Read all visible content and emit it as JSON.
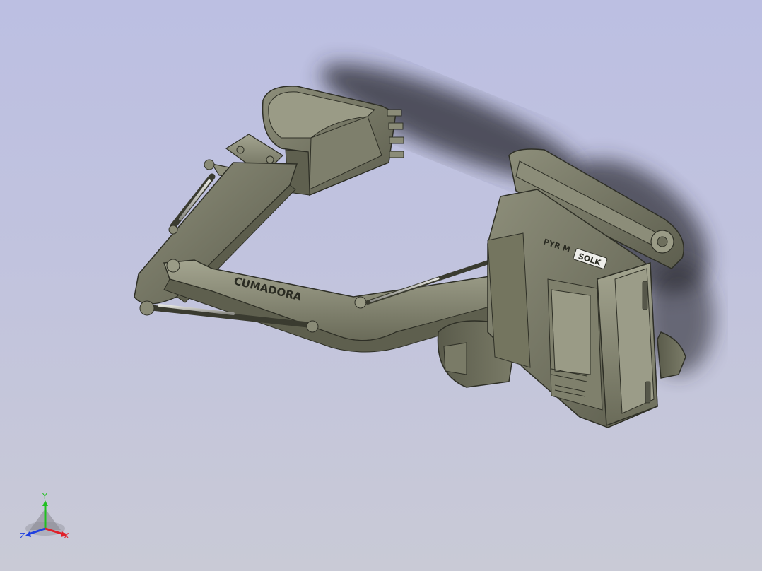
{
  "viewport": {
    "background_top": "#bcbfe2",
    "background_bottom": "#c9cad6"
  },
  "model": {
    "name_icon": "excavator-3d-model",
    "body_color": "#6f705e",
    "boom_lettering": "CUMADORA",
    "cab_lettering_top": "PYR M",
    "cab_badge": "SOLK"
  },
  "triad": {
    "x_label": "X",
    "y_label": "Y",
    "z_label": "Z",
    "x_color": "#e0202a",
    "y_color": "#20c020",
    "z_color": "#2040e0"
  }
}
